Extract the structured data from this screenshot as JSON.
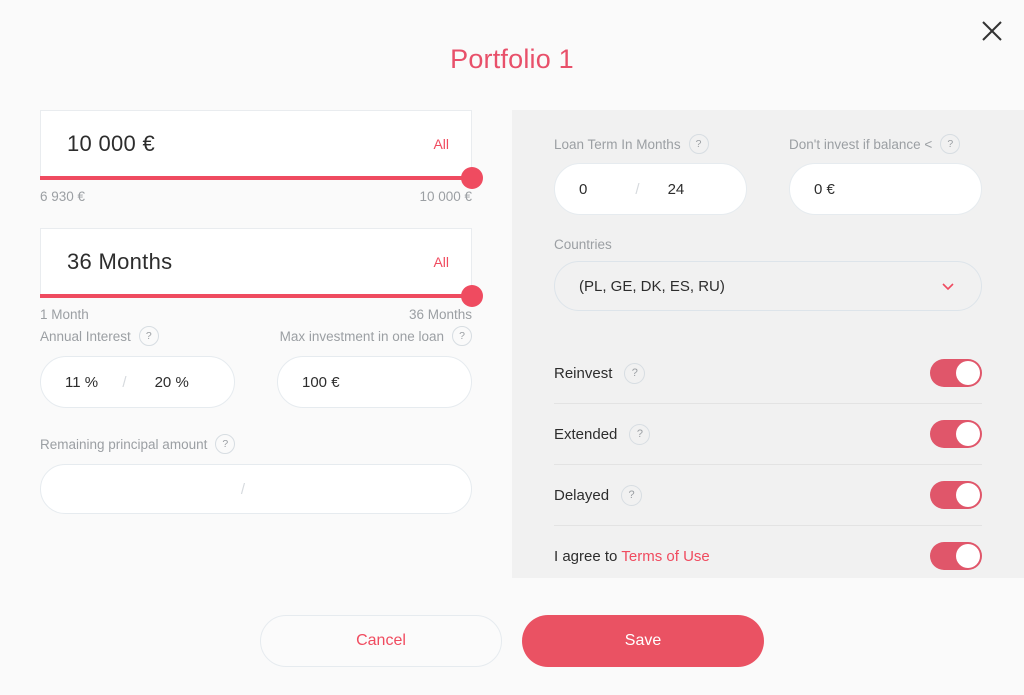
{
  "accent": "#ef4b60",
  "panel_bg": "#f1f1f1",
  "page_bg": "#fafafa",
  "header": {
    "title": "Portfolio 1",
    "close_icon": "close-icon"
  },
  "left": {
    "amount": {
      "value": "10 000 €",
      "all_label": "All",
      "min_label": "6 930 €",
      "max_label": "10 000 €"
    },
    "term": {
      "value": "36 Months",
      "all_label": "All",
      "min_label": "1 Month",
      "max_label": "36 Months"
    },
    "annual_interest": {
      "label": "Annual Interest",
      "help": "?",
      "from": "11 %",
      "separator": "/",
      "to": "20 %"
    },
    "max_investment": {
      "label": "Max investment in one loan",
      "help": "?",
      "value": "100 €"
    },
    "remaining_principal": {
      "label": "Remaining principal amount",
      "help": "?",
      "from": "",
      "separator": "/",
      "to": ""
    }
  },
  "right": {
    "loan_term": {
      "label": "Loan Term In Months",
      "help": "?",
      "from": "0",
      "separator": "/",
      "to": "24"
    },
    "dont_invest": {
      "label": "Don't invest if balance <",
      "help": "?",
      "value": "0 €"
    },
    "countries": {
      "label": "Countries",
      "value": "(PL, GE, DK, ES, RU)",
      "chevron_icon": "chevron-down-icon"
    },
    "toggles": [
      {
        "label": "Reinvest",
        "help": "?",
        "on": true
      },
      {
        "label": "Extended",
        "help": "?",
        "on": true
      },
      {
        "label": "Delayed",
        "help": "?",
        "on": true
      }
    ],
    "terms": {
      "prefix": "I agree to ",
      "link": "Terms of Use",
      "on": true
    }
  },
  "footer": {
    "cancel_label": "Cancel",
    "save_label": "Save"
  }
}
